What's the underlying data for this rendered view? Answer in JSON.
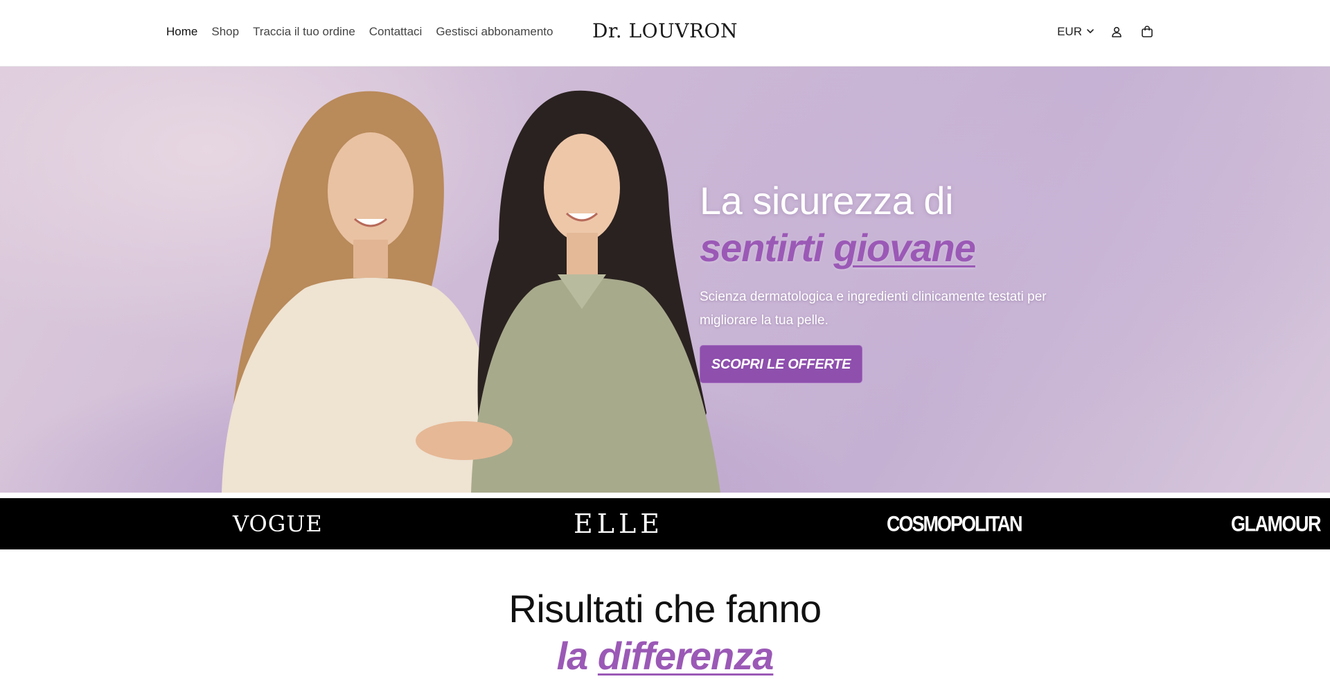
{
  "header": {
    "nav": [
      {
        "label": "Home",
        "active": true
      },
      {
        "label": "Shop",
        "active": false
      },
      {
        "label": "Traccia il tuo ordine",
        "active": false
      },
      {
        "label": "Contattaci",
        "active": false
      },
      {
        "label": "Gestisci abbonamento",
        "active": false
      }
    ],
    "logo": "Dr. LOUVRON",
    "currency": "EUR",
    "icons": [
      "chevron-down-icon",
      "account-icon",
      "cart-icon"
    ]
  },
  "hero": {
    "title_line1": "La sicurezza di",
    "title_accent_plain": "sentirti ",
    "title_accent_underlined": "giovane",
    "subtitle": "Scienza dermatologica e ingredienti clinicamente testati per migliorare la tua pelle.",
    "cta_label": "SCOPRI LE OFFERTE",
    "image_alt": "photo-two-smiling-women"
  },
  "press": {
    "logos": [
      "VOGUE",
      "ELLE",
      "COSMOPOLITAN",
      "GLAMOUR"
    ]
  },
  "results": {
    "title_line1": "Risultati che fanno",
    "title_accent_plain": "la ",
    "title_accent_underlined": "differenza"
  },
  "colors": {
    "accent": "#9b59b6",
    "cta_background": "#8e4fad",
    "press_background": "#000000"
  }
}
